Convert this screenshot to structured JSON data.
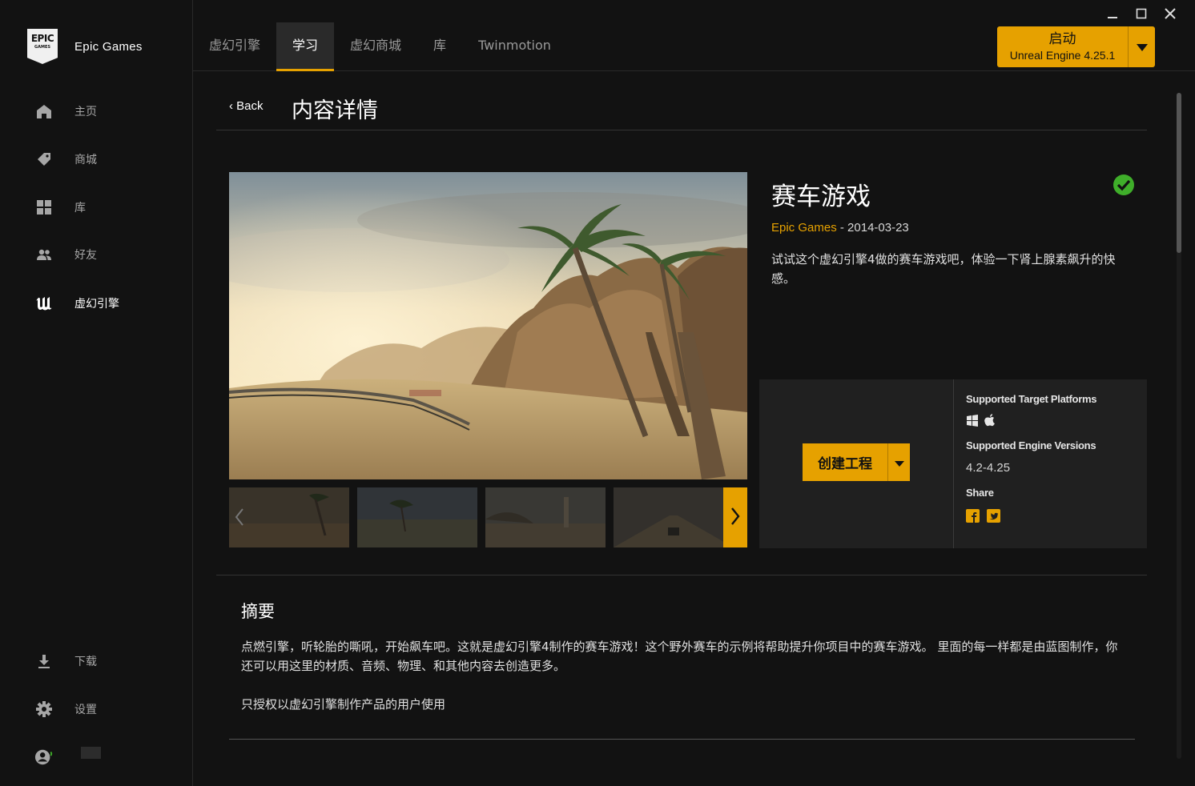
{
  "app": {
    "brand_name": "Epic Games",
    "logo_line1": "EPIC",
    "logo_line2": "GAMES"
  },
  "sidebar": {
    "items": [
      {
        "label": "主页",
        "icon": "home-icon"
      },
      {
        "label": "商城",
        "icon": "tag-icon"
      },
      {
        "label": "库",
        "icon": "grid-icon"
      },
      {
        "label": "好友",
        "icon": "friends-icon"
      },
      {
        "label": "虚幻引擎",
        "icon": "unreal-icon",
        "active": true
      }
    ],
    "bottom": [
      {
        "label": "下载",
        "icon": "download-icon"
      },
      {
        "label": "设置",
        "icon": "gear-icon"
      }
    ]
  },
  "tabs": [
    {
      "label": "虚幻引擎"
    },
    {
      "label": "学习",
      "active": true
    },
    {
      "label": "虚幻商城"
    },
    {
      "label": "库"
    },
    {
      "label": "Twinmotion"
    }
  ],
  "launch": {
    "label": "启动",
    "version": "Unreal Engine 4.25.1"
  },
  "header": {
    "back": "Back",
    "title": "内容详情"
  },
  "product": {
    "title": "赛车游戏",
    "publisher": "Epic Games",
    "date_sep": " - ",
    "date": "2014-03-23",
    "description": "试试这个虚幻引擎4做的赛车游戏吧，体验一下肾上腺素飙升的快感。",
    "owned": true
  },
  "actions": {
    "create_label": "创建工程",
    "platforms_heading": "Supported Target Platforms",
    "platforms": [
      "windows-icon",
      "apple-icon"
    ],
    "versions_heading": "Supported Engine Versions",
    "versions": "4.2-4.25",
    "share_heading": "Share",
    "share": [
      "facebook-icon",
      "twitter-icon"
    ]
  },
  "summary": {
    "title": "摘要",
    "body": "点燃引擎，听轮胎的嘶吼，开始飙车吧。这就是虚幻引擎4制作的赛车游戏！这个野外赛车的示例将帮助提升你项目中的赛车游戏。 里面的每一样都是由蓝图制作，你还可以用这里的材质、音频、物理、和其他内容去创造更多。",
    "license": "只授权以虚幻引擎制作产品的用户使用"
  },
  "colors": {
    "accent": "#e6a100",
    "background": "#121212",
    "panel": "#202020",
    "success": "#3fae2a"
  }
}
